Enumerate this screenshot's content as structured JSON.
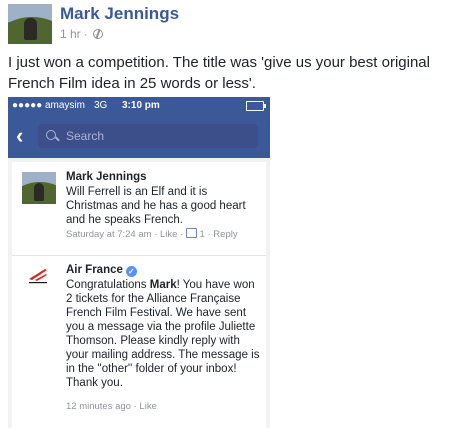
{
  "post": {
    "author": "Mark Jennings",
    "time": "1 hr",
    "separator": "·",
    "body": "I just won a competition. The title was 'give us your best original French Film idea in 25 words or less'."
  },
  "phone": {
    "status": {
      "carrier": "●●●●● amaysim",
      "network": "3G",
      "time": "3:10 pm",
      "battery_level": 0
    },
    "search_placeholder": "Search",
    "comments": [
      {
        "author": "Mark Jennings",
        "text": "Will Ferrell is an Elf and it is Christmas and he has a good heart and he speaks French.",
        "time": "Saturday at 7:24 am",
        "like": "Like",
        "likes": "1",
        "reply": "Reply"
      },
      {
        "author": "Air France",
        "text_1": "Congratulations ",
        "text_bold": "Mark",
        "text_2": "! You have won 2 tickets for the Alliance Française French Film Festival. We have sent you a message via the profile Juliette Thomson. Please kindly reply with your mailing address. The message is in the ''other'' folder of your inbox! Thank you.",
        "time": "12 minutes ago",
        "like": "Like"
      }
    ]
  },
  "colors": {
    "facebook_blue": "#3b5998",
    "link_blue": "#3b5998",
    "meta_gray": "#90949c",
    "air_france_red": "#e2231a"
  }
}
